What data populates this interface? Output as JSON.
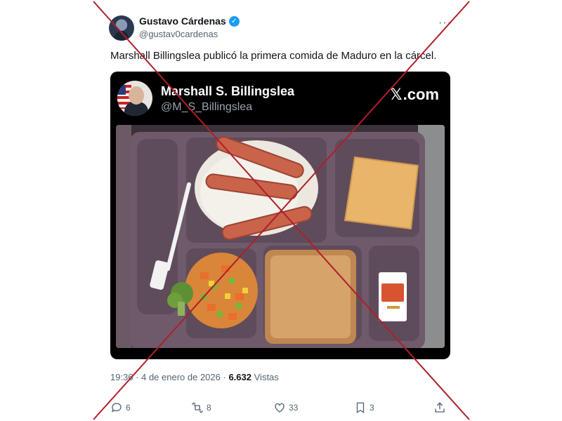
{
  "author": {
    "name": "Gustavo Cárdenas",
    "handle": "@gustav0cardenas",
    "verified_icon": "check-badge-icon"
  },
  "more_icon": "···",
  "tweet_text": "Marshall Billingslea publicó la primera comida de Maduro en la cárcel.",
  "quoted": {
    "name": "Marshall S. Billingslea",
    "handle": "@M_S_Billingslea",
    "brand_symbol": "𝕏",
    "brand_text": ".com"
  },
  "photo_alt_icon": "meal-tray-image",
  "meta": {
    "time": "19:36",
    "separator": " · ",
    "date": "4 de enero de 2026",
    "views_count": "6.632",
    "views_label": "Vistas"
  },
  "actions": {
    "replies": "6",
    "reposts": "8",
    "likes": "33",
    "bookmarks": "3"
  },
  "colors": {
    "accent": "#1d9bf0",
    "cross": "#b01e2a"
  }
}
